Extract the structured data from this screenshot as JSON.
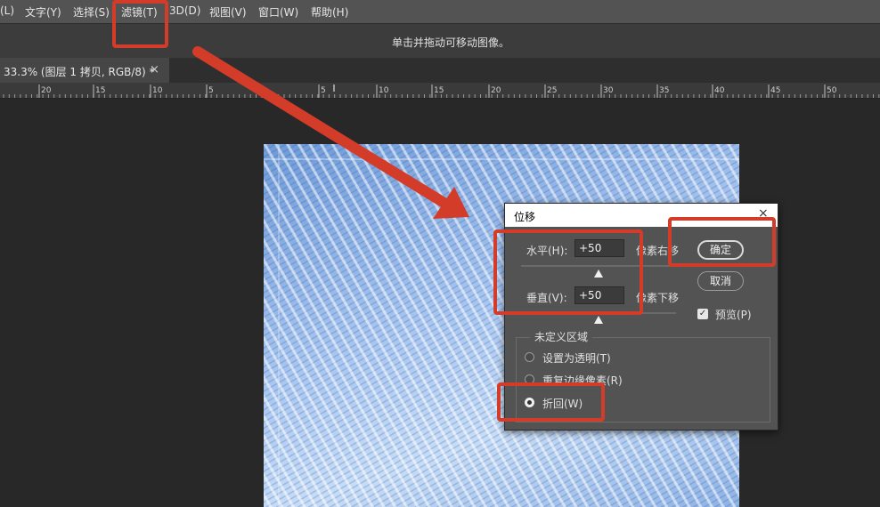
{
  "menubar": {
    "items": [
      {
        "label": "(L)"
      },
      {
        "label": "文字(Y)"
      },
      {
        "label": "选择(S)"
      },
      {
        "label": "滤镜(T)"
      },
      {
        "label": "3D(D)"
      },
      {
        "label": "视图(V)"
      },
      {
        "label": "窗口(W)"
      },
      {
        "label": "帮助(H)"
      }
    ]
  },
  "options_bar": {
    "hint": "单击并拖动可移动图像。"
  },
  "document_tab": {
    "title": "33.3% (图层 1 拷贝, RGB/8) *",
    "close": "×"
  },
  "ruler": {
    "labels": [
      "20",
      "15",
      "10",
      "5",
      "5",
      "10",
      "15",
      "20",
      "25",
      "30",
      "35",
      "40",
      "45",
      "50"
    ]
  },
  "dialog": {
    "title": "位移",
    "close": "×",
    "horizontal": {
      "label": "水平(H):",
      "value": "+50",
      "unit": "像素右移",
      "slider_fraction": 0.5
    },
    "vertical": {
      "label": "垂直(V):",
      "value": "+50",
      "unit": "像素下移",
      "slider_fraction": 0.5
    },
    "ok_label": "确定",
    "cancel_label": "取消",
    "preview": {
      "label": "预览(P)",
      "checked": true
    },
    "undefined_area": {
      "title": "未定义区域",
      "options": [
        {
          "label": "设置为透明(T)",
          "checked": false
        },
        {
          "label": "重复边缘像素(R)",
          "checked": false
        },
        {
          "label": "折回(W)",
          "checked": true
        }
      ]
    }
  },
  "colors": {
    "annotation": "#d43c2a",
    "background": "#282828",
    "menubar": "#535353",
    "dialog": "#535353"
  }
}
